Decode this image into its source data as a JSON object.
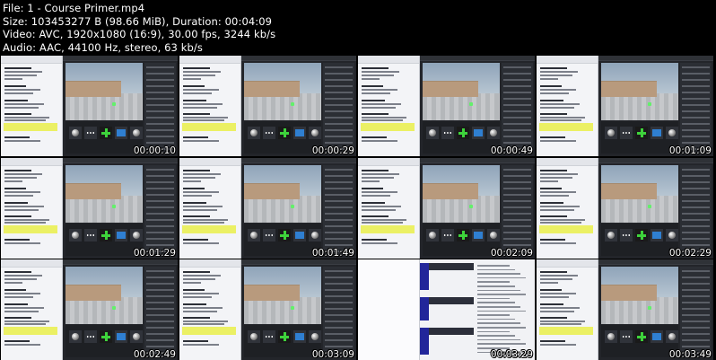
{
  "header": {
    "file": "File: 1 - Course Primer.mp4",
    "size": "Size: 103453277 B (98.66 MiB), Duration: 00:04:09",
    "video": "Video: AVC, 1920x1080 (16:9), 30.00 fps, 3244 kb/s",
    "audio": "Audio: AAC, 44100 Hz, stereo, 63 kb/s"
  },
  "thumbnails": [
    {
      "timestamp": "00:00:10",
      "scene": "editor"
    },
    {
      "timestamp": "00:00:29",
      "scene": "editor"
    },
    {
      "timestamp": "00:00:49",
      "scene": "editor"
    },
    {
      "timestamp": "00:01:09",
      "scene": "editor"
    },
    {
      "timestamp": "00:01:29",
      "scene": "editor"
    },
    {
      "timestamp": "00:01:49",
      "scene": "editor"
    },
    {
      "timestamp": "00:02:09",
      "scene": "editor"
    },
    {
      "timestamp": "00:02:29",
      "scene": "editor"
    },
    {
      "timestamp": "00:02:49",
      "scene": "editor"
    },
    {
      "timestamp": "00:03:09",
      "scene": "editor"
    },
    {
      "timestamp": "00:03:29",
      "scene": "table"
    },
    {
      "timestamp": "00:03:49",
      "scene": "editor"
    }
  ],
  "colors": {
    "background": "#000000",
    "highlight": "#ebf064",
    "viewport_sky": "#a5b6c6",
    "wall": "#b89a7d",
    "marker_green": "#63f06b",
    "plus_green": "#3ed33b",
    "asset_blue": "#2f7fd1",
    "table_blue": "#22269a"
  }
}
